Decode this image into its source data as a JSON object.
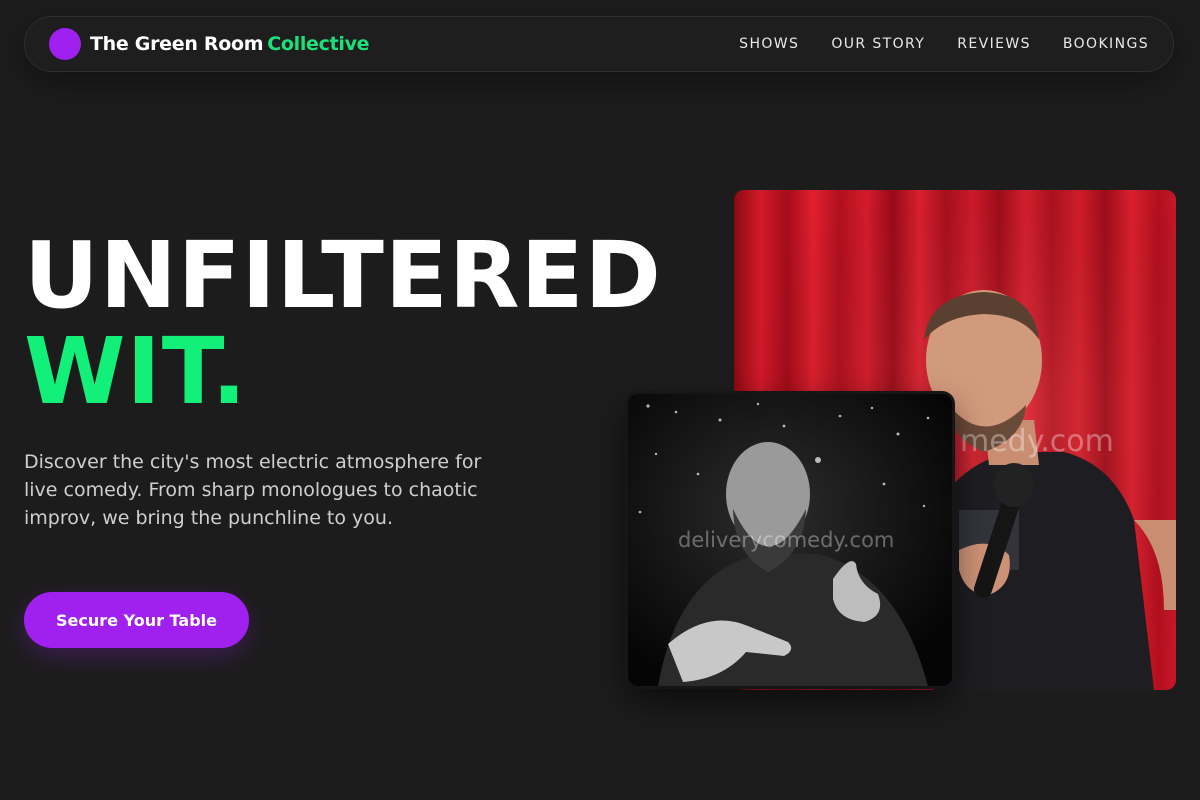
{
  "brand": {
    "name_primary": "The Green Room",
    "name_accent": "Collective",
    "accent_color": "#1ee07a",
    "logo_color": "#a020f0"
  },
  "nav": {
    "items": [
      {
        "label": "SHOWS"
      },
      {
        "label": "OUR STORY"
      },
      {
        "label": "REVIEWS"
      },
      {
        "label": "BOOKINGS"
      }
    ]
  },
  "hero": {
    "title_line1": "UNFILTERED",
    "title_line2": "WIT.",
    "description": "Discover the city's most electric atmosphere for live comedy. From sharp monologues to chaotic improv, we bring the punchline to you.",
    "cta_label": "Secure Your Table"
  },
  "images": {
    "main": {
      "subject": "comedian with microphone on red curtain stage",
      "watermark": "medy.com"
    },
    "secondary": {
      "subject": "black and white photo of bald bearded comedian pointing",
      "watermark": "deliverycomedy.com"
    }
  },
  "colors": {
    "background": "#1c1c1c",
    "cta": "#a020f0",
    "highlight_green": "#12f07a"
  }
}
